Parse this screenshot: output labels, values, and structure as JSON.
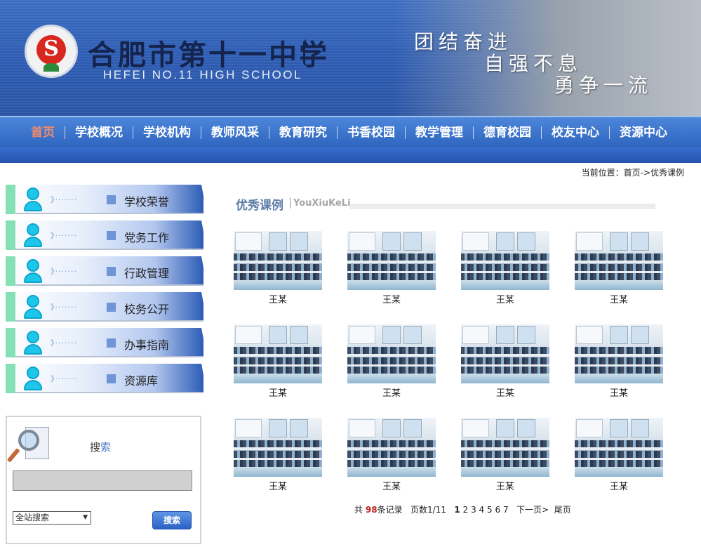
{
  "header": {
    "school_name_cn": "合肥市第十一中学",
    "school_name_en": "HEFEI NO.11 HIGH SCHOOL",
    "logo_letter": "S",
    "slogans": [
      "团结奋进",
      "自强不息",
      "勇争一流"
    ]
  },
  "nav": {
    "items": [
      "首页",
      "学校概况",
      "学校机构",
      "教师风采",
      "教育研究",
      "书香校园",
      "教学管理",
      "德育校园",
      "校友中心",
      "资源中心"
    ],
    "active_index": 0,
    "active_color": "#f28a6a"
  },
  "breadcrumb": "当前位置：首页->优秀课例",
  "sidebar": {
    "items": [
      "学校荣誉",
      "党务工作",
      "行政管理",
      "校务公开",
      "办事指南",
      "资源库"
    ],
    "dots": "》·······"
  },
  "search": {
    "title_a": "搜",
    "title_b": "索",
    "input_value": "",
    "select_value": "全站搜索",
    "button_label": "搜索"
  },
  "section": {
    "title": "优秀课例",
    "title_en": "YouXiuKeLi"
  },
  "gallery": {
    "captions": [
      "王某",
      "王某",
      "王某",
      "王某",
      "王某",
      "王某",
      "王某",
      "王某",
      "王某",
      "王某",
      "王某",
      "王某"
    ]
  },
  "pager": {
    "total_prefix": "共",
    "total": "98",
    "total_suffix": "条记录",
    "pages_label": "页数1/11",
    "pages": [
      "1",
      "2",
      "3",
      "4",
      "5",
      "6",
      "7"
    ],
    "current_page": "1",
    "next_label": "下一页>",
    "last_label": "尾页"
  }
}
